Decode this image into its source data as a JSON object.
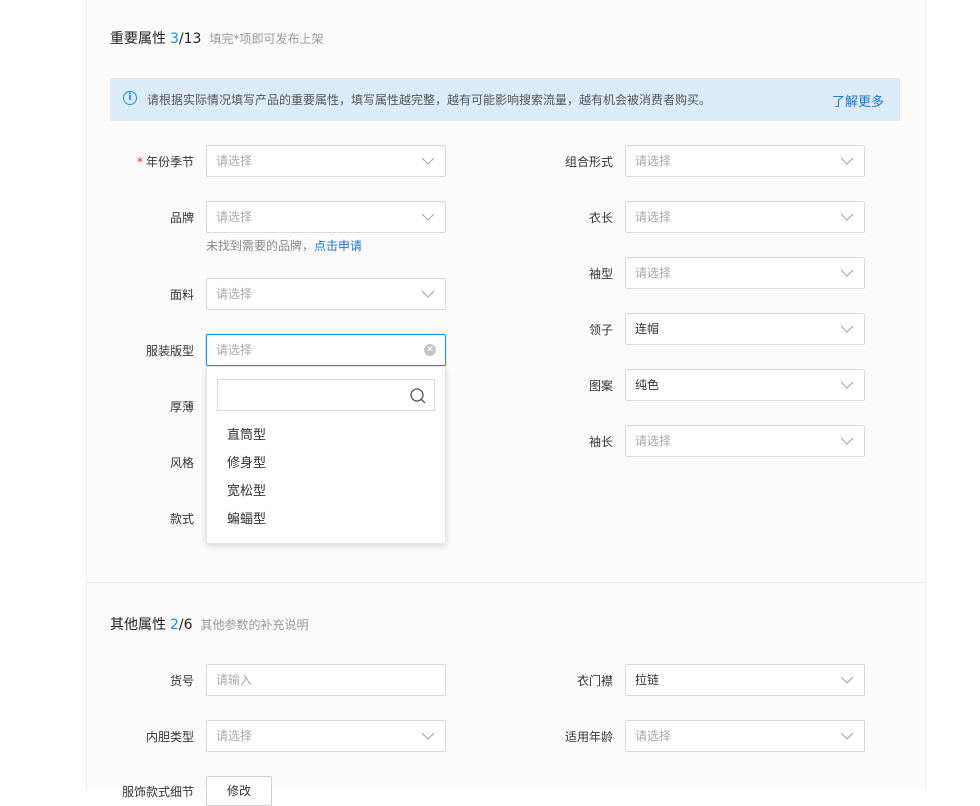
{
  "important": {
    "title": "重要属性",
    "count": "3",
    "total": "/13",
    "hint": "填完*项即可发布上架",
    "notice": "请根据实际情况填写产品的重要属性，填写属性越完整，越有可能影响搜索流量，越有机会被消费者购买。",
    "notice_link": "了解更多",
    "fields_left": [
      {
        "label": "年份季节",
        "required": "*",
        "value": "请选择"
      },
      {
        "label": "品牌",
        "value": "请选择"
      },
      {
        "label": "面料",
        "value": "请选择"
      },
      {
        "label": "服装版型",
        "value": "请选择"
      },
      {
        "label": "厚薄"
      },
      {
        "label": "风格"
      },
      {
        "label": "款式"
      }
    ],
    "brand_help": "未找到需要的品牌，",
    "brand_help_link": "点击申请",
    "fields_right": [
      {
        "label": "组合形式",
        "value": "请选择"
      },
      {
        "label": "衣长",
        "value": "请选择"
      },
      {
        "label": "袖型",
        "value": "请选择"
      },
      {
        "label": "领子",
        "value": "连帽"
      },
      {
        "label": "图案",
        "value": "纯色"
      },
      {
        "label": "袖长",
        "value": "请选择"
      }
    ],
    "dropdown_options": [
      "直筒型",
      "修身型",
      "宽松型",
      "蝙蝠型"
    ]
  },
  "other": {
    "title": "其他属性",
    "count": "2",
    "total": "/6",
    "hint": "其他参数的补充说明",
    "fields_left": [
      {
        "label": "货号",
        "placeholder": "请输入"
      },
      {
        "label": "内胆类型",
        "value": "请选择"
      },
      {
        "label": "服饰款式细节",
        "button": "修改"
      }
    ],
    "fields_right": [
      {
        "label": "衣门襟",
        "value": "拉链"
      },
      {
        "label": "适用年龄",
        "value": "请选择"
      }
    ]
  },
  "icons": {
    "info": "info-icon",
    "arrow": "chevron-down-icon",
    "clear": "clear-icon",
    "search": "search-icon"
  },
  "colors": {
    "accent": "#1890ff",
    "required": "#f5222d",
    "notice_bg": "#dcebf9"
  }
}
